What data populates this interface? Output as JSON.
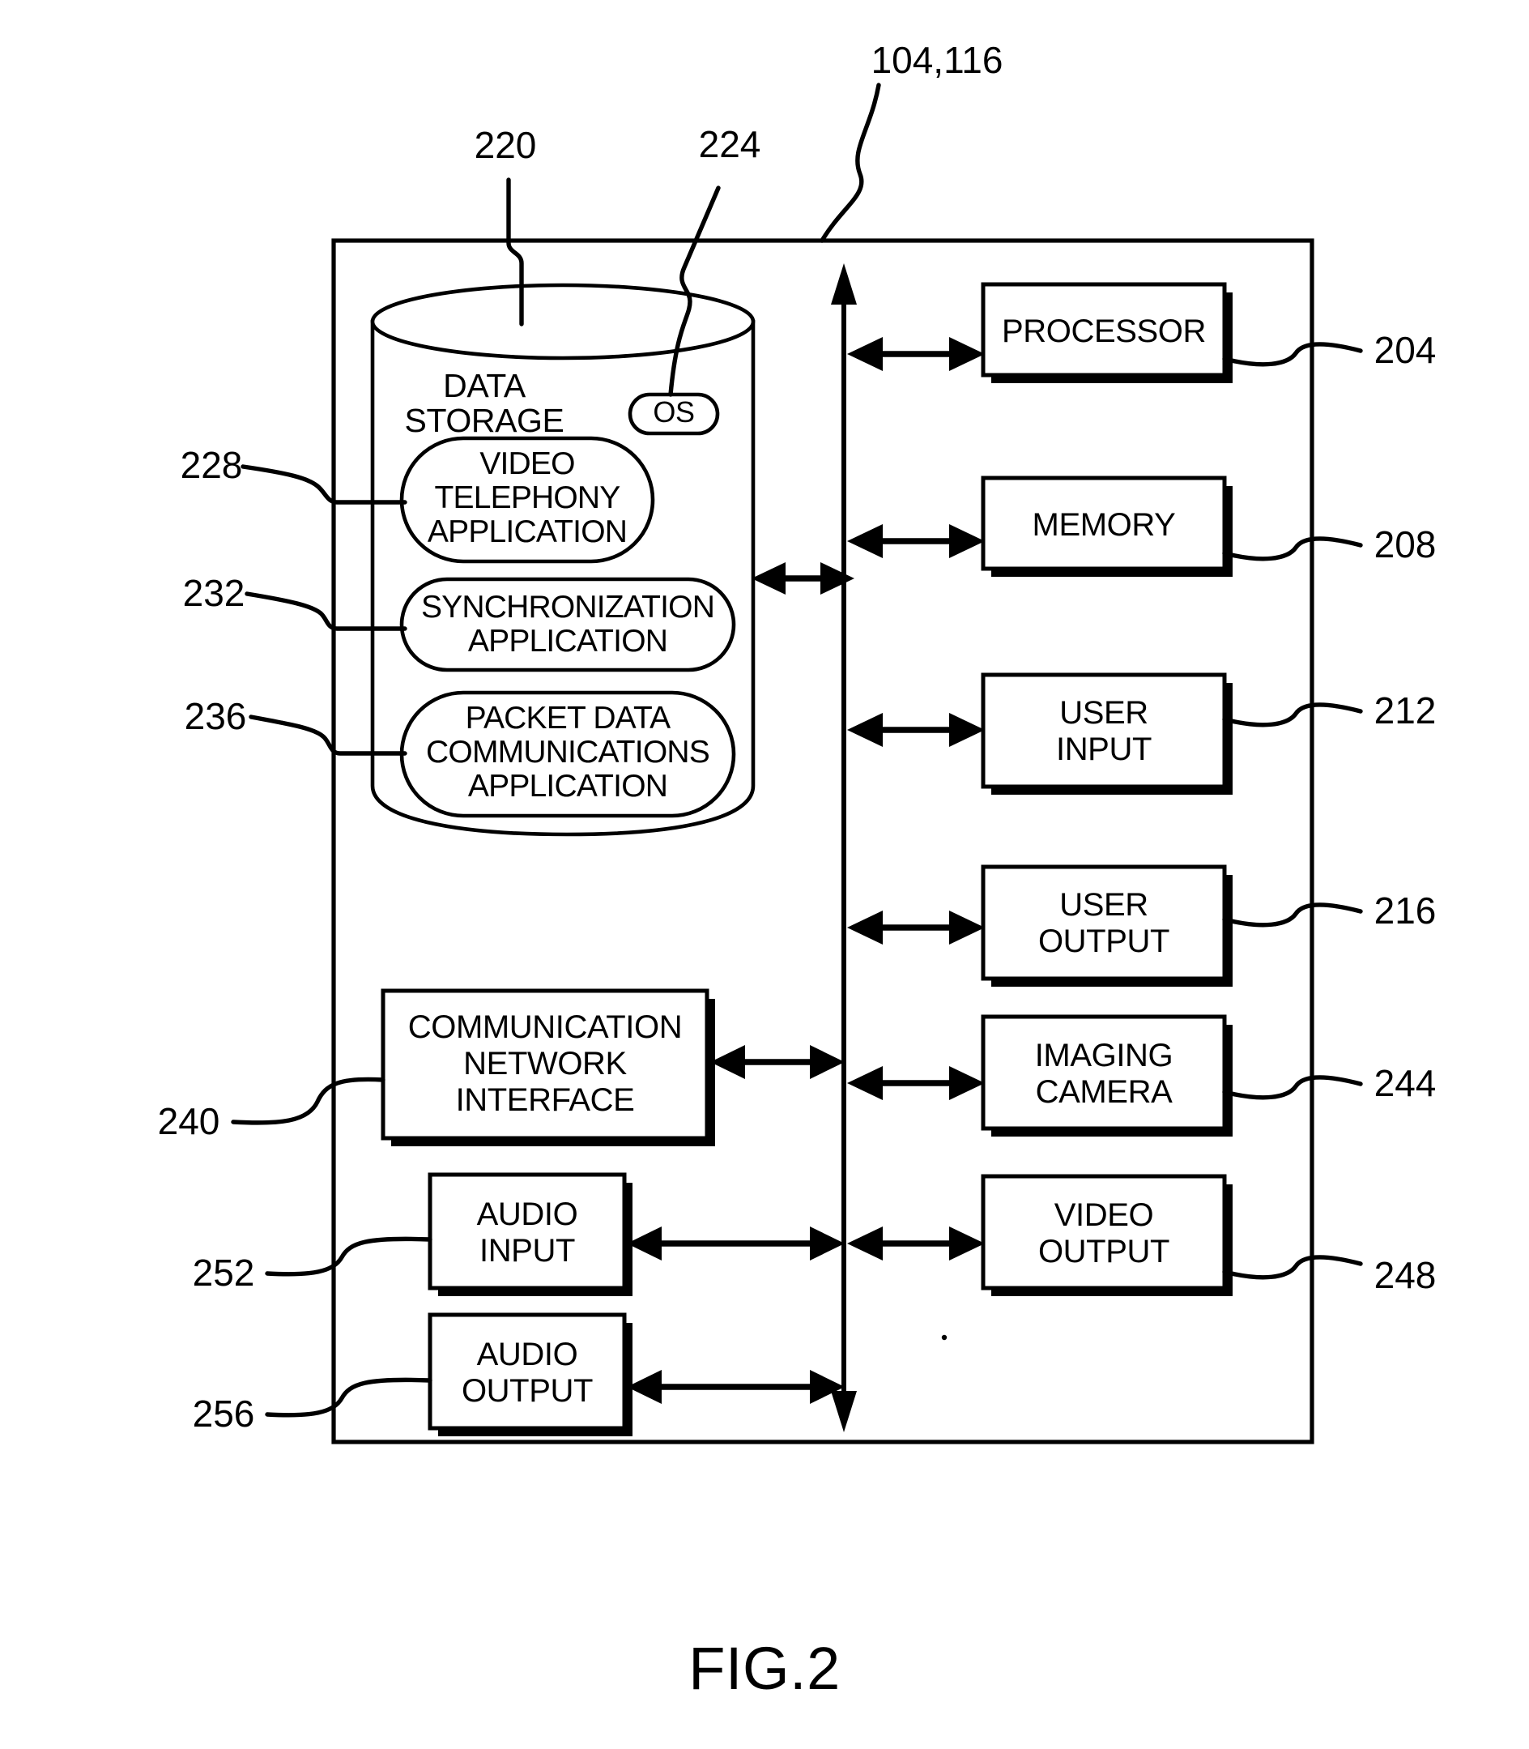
{
  "figure": {
    "caption": "FIG.2",
    "device_ref": "104,116"
  },
  "storage": {
    "label_line1": "DATA",
    "label_line2": "STORAGE",
    "ref": "220",
    "os": {
      "label": "OS",
      "ref": "224"
    },
    "applications": [
      {
        "ref": "228",
        "lines": [
          "VIDEO",
          "TELEPHONY",
          "APPLICATION"
        ]
      },
      {
        "ref": "232",
        "lines": [
          "SYNCHRONIZATION",
          "APPLICATION"
        ]
      },
      {
        "ref": "236",
        "lines": [
          "PACKET DATA",
          "COMMUNICATIONS",
          "APPLICATION"
        ]
      }
    ]
  },
  "right_blocks": [
    {
      "ref": "204",
      "lines": [
        "PROCESSOR"
      ]
    },
    {
      "ref": "208",
      "lines": [
        "MEMORY"
      ]
    },
    {
      "ref": "212",
      "lines": [
        "USER",
        "INPUT"
      ]
    },
    {
      "ref": "216",
      "lines": [
        "USER",
        "OUTPUT"
      ]
    },
    {
      "ref": "244",
      "lines": [
        "IMAGING",
        "CAMERA"
      ]
    },
    {
      "ref": "248",
      "lines": [
        "VIDEO",
        "OUTPUT"
      ]
    }
  ],
  "left_blocks": [
    {
      "ref": "240",
      "lines": [
        "COMMUNICATION",
        "NETWORK",
        "INTERFACE"
      ]
    },
    {
      "ref": "252",
      "lines": [
        "AUDIO",
        "INPUT"
      ]
    },
    {
      "ref": "256",
      "lines": [
        "AUDIO",
        "OUTPUT"
      ]
    }
  ],
  "colors": {
    "ink": "#000000",
    "paper": "#ffffff"
  }
}
